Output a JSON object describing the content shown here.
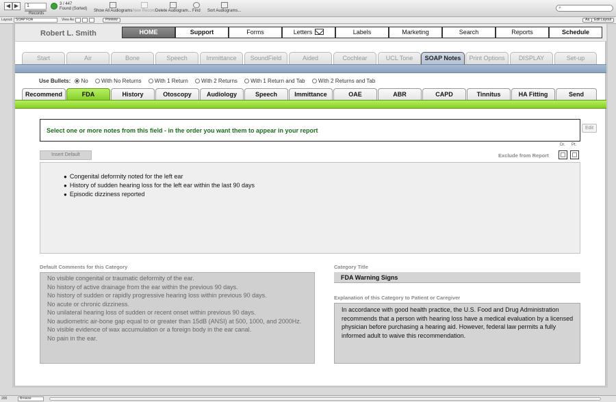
{
  "toolbar": {
    "record_value": "1",
    "records_label": "Records",
    "found_count": "3 / 447",
    "found_label": "Found (Sorted)",
    "buttons": [
      "Show All Audiograms",
      "New Record",
      "Delete Audiogram...",
      "Find",
      "Sort Audiograms..."
    ],
    "search_placeholder": ""
  },
  "layout_bar": {
    "layout_label": "Layout:",
    "layout_value": "SOAP FDA",
    "view_as_label": "View As:",
    "preview_label": "Preview",
    "aa_label": "Aa",
    "edit_layout_label": "Edit Layout"
  },
  "header": {
    "patient_name": "Robert L. Smith",
    "menu": [
      "HOME",
      "Support",
      "Forms",
      "Letters",
      "Labels",
      "Marketing",
      "Search",
      "Reports",
      "Schedule"
    ]
  },
  "main_tabs": {
    "items": [
      "Start",
      "Air",
      "Bone",
      "Speech",
      "Immittance",
      "SoundField",
      "Aided",
      "Cochlear",
      "UCL Tone",
      "SOAP Notes",
      "Print Options",
      "DISPLAY",
      "Set-up"
    ],
    "active": "SOAP Notes"
  },
  "bullets": {
    "label": "Use Bullets:",
    "options": [
      "No",
      "With No Returns",
      "With 1 Return",
      "With 2 Returns",
      "With 1 Return and Tab",
      "With 2 Returns and Tab"
    ],
    "selected": "No"
  },
  "soap_tabs": {
    "items": [
      "Recommend",
      "FDA",
      "History",
      "Otoscopy",
      "Audiology",
      "Speech",
      "Immittance",
      "OAE",
      "ABR",
      "CAPD",
      "Tinnitus",
      "HA Fitting",
      "Send"
    ],
    "active": "FDA"
  },
  "instructions": "Select one or more notes from this field -  in the order you want them to appear in your report",
  "edit_label": "Edit",
  "insert_default_label": "Insert Default",
  "exclude_label": "Exclude from Report",
  "dr_label": "Dr.",
  "pt_label": "Pt.",
  "notes": [
    "Congenital deformity noted for the left ear",
    "History of sudden hearing loss for the left ear within the last 90 days",
    "Episodic dizziness reported"
  ],
  "default_comments": {
    "label": "Default Comments for this Category",
    "lines": [
      "No visible congenital or traumatic deformity of the ear.",
      "No history of active drainage from the ear within the previous 90 days.",
      "No history of sudden or rapidly progressive hearing loss within previous 90 days.",
      "No acute or chronic dizziness.",
      "No unilateral hearing loss of sudden or recent onset within previous 90 days.",
      "No  audiometric air-bone gap equal to or greater than 15dB (ANSI) at 500, 1000, and 2000Hz.",
      "No visible evidence of wax accumulation or a foreign body in the ear canal.",
      "No pain in the ear."
    ]
  },
  "category_title": {
    "label": "Category Title",
    "value": "FDA Warning Signs"
  },
  "explanation": {
    "label": "Explanation of this Category to Patient or Caregiver",
    "text": "In accordance with good health practice, the U.S. Food and Drug Administration recommends that a person with hearing loss have a medical evaluation by a licensed physician before purchasing a hearing aid. However, federal law permits a fully informed adult to waive this recommendation."
  },
  "status_bar": {
    "zoom": "200",
    "mode": "Browse"
  },
  "colors": {
    "active_soap_tab": "#86d02a",
    "active_main_tab": "#b4c2d4",
    "instruction_text": "#1e6b1e"
  }
}
